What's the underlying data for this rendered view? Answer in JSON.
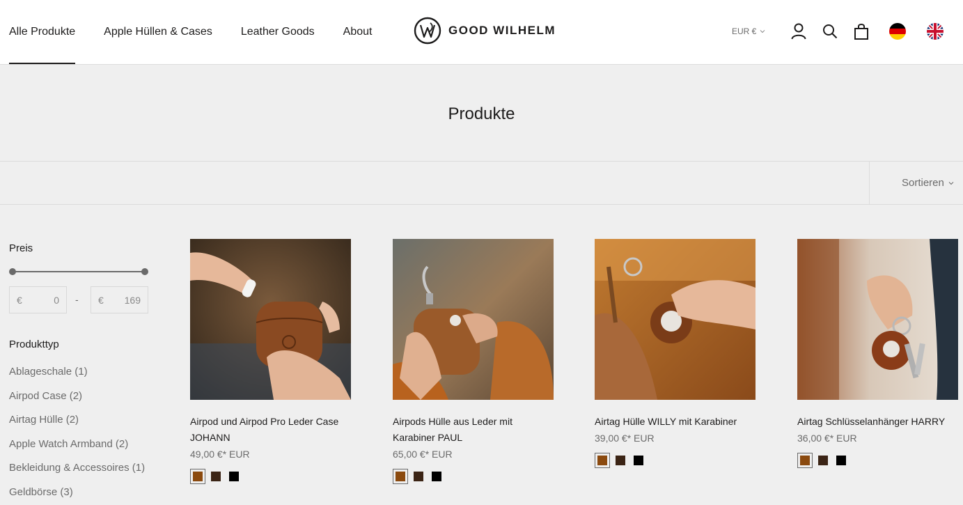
{
  "nav": {
    "items": [
      {
        "label": "Alle Produkte",
        "active": true
      },
      {
        "label": "Apple Hüllen & Cases",
        "active": false
      },
      {
        "label": "Leather Goods",
        "active": false
      },
      {
        "label": "About",
        "active": false
      }
    ]
  },
  "logo": {
    "text": "GOOD WILHELM"
  },
  "header": {
    "currency": "EUR €",
    "icons": [
      "account-icon",
      "search-icon",
      "cart-icon"
    ],
    "flags": [
      "flag-de-icon",
      "flag-uk-icon"
    ]
  },
  "page": {
    "title": "Produkte"
  },
  "toolbar": {
    "sort_label": "Sortieren"
  },
  "filters": {
    "price": {
      "heading": "Preis",
      "currency_symbol": "€",
      "min": "0",
      "max": "169",
      "separator": "-"
    },
    "type": {
      "heading": "Produkttyp",
      "items": [
        {
          "label": "Ablageschale (1)"
        },
        {
          "label": "Airpod Case (2)"
        },
        {
          "label": "Airtag Hülle (2)"
        },
        {
          "label": "Apple Watch Armband (2)"
        },
        {
          "label": "Bekleidung & Accessoires (1)"
        },
        {
          "label": "Geldbörse (3)"
        }
      ]
    }
  },
  "products": [
    {
      "title": "Airpod und Airpod Pro Leder Case JOHANN",
      "price": "49,00 €* EUR",
      "swatches": [
        "#8b4a0f",
        "#3b2415",
        "#000000"
      ]
    },
    {
      "title": "Airpods Hülle aus Leder mit Karabiner PAUL",
      "price": "65,00 €* EUR",
      "swatches": [
        "#8b4a0f",
        "#3b2415",
        "#000000"
      ]
    },
    {
      "title": "Airtag Hülle WILLY mit Karabiner",
      "price": "39,00 €* EUR",
      "swatches": [
        "#8b4a0f",
        "#3b2415",
        "#000000"
      ]
    },
    {
      "title": "Airtag Schlüsselanhänger HARRY",
      "price": "36,00 €* EUR",
      "swatches": [
        "#8b4a0f",
        "#3b2415",
        "#000000"
      ]
    }
  ],
  "colors": {
    "text": "#1c1b1b",
    "muted": "#6a6a6a",
    "background": "#efefef",
    "border": "#dcdcdc"
  }
}
